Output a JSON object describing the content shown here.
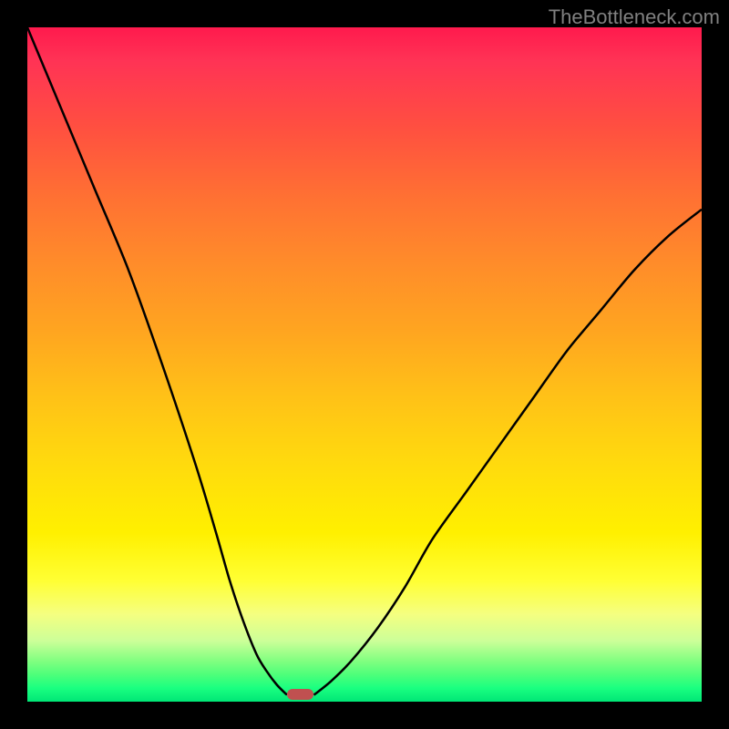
{
  "watermark": "TheBottleneck.com",
  "chart_data": {
    "type": "line",
    "title": "",
    "xlabel": "",
    "ylabel": "",
    "xlim": [
      0,
      100
    ],
    "ylim": [
      0,
      100
    ],
    "series": [
      {
        "name": "left-curve",
        "x": [
          0,
          5,
          10,
          15,
          20,
          25,
          28,
          30,
          32,
          34,
          35.5,
          37,
          38.5
        ],
        "y": [
          100,
          88,
          76,
          64,
          50,
          35,
          25,
          18,
          12,
          7,
          4.5,
          2.5,
          1
        ]
      },
      {
        "name": "right-curve",
        "x": [
          42.5,
          45,
          48,
          52,
          56,
          60,
          65,
          70,
          75,
          80,
          85,
          90,
          95,
          100
        ],
        "y": [
          1,
          3,
          6,
          11,
          17,
          24,
          31,
          38,
          45,
          52,
          58,
          64,
          69,
          73
        ]
      }
    ],
    "marker": {
      "name": "bottleneck-marker",
      "x_center": 40.5,
      "width": 4,
      "color": "#c05050"
    },
    "background_gradient": {
      "top_color": "#ff1a4d",
      "mid_color": "#ffdb0d",
      "bottom_color": "#00e676"
    }
  }
}
